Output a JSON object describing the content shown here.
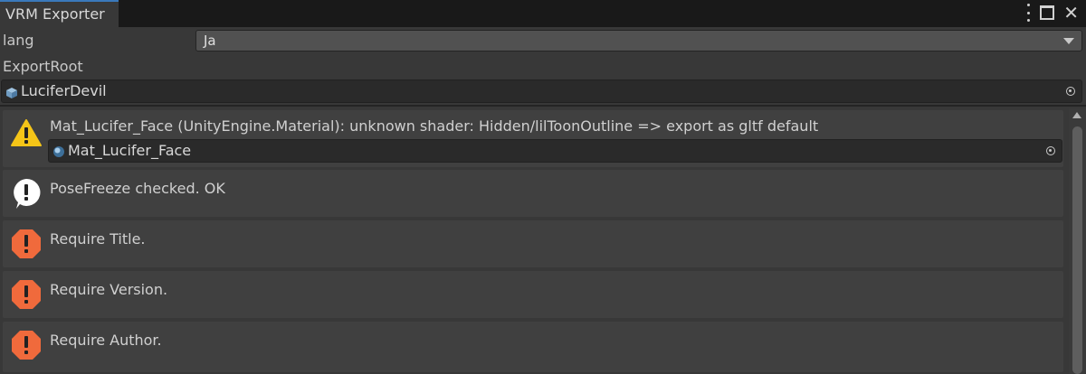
{
  "window": {
    "tab_title": "VRM Exporter",
    "menu_icon": "kebab-menu-icon",
    "maximize_icon": "maximize-icon",
    "close_icon": "close-icon",
    "close_glyph": "✕"
  },
  "settings": {
    "lang_label": "lang",
    "lang_value": "Ja",
    "export_root_label": "ExportRoot",
    "export_root_value": "LuciferDevil",
    "export_root_icon": "prefab-cube-icon"
  },
  "messages": [
    {
      "type": "warning",
      "icon": "warning-icon",
      "text": "Mat_Lucifer_Face (UnityEngine.Material): unknown shader: Hidden/lilToonOutline => export as gltf default",
      "object_field": "Mat_Lucifer_Face",
      "object_icon": "material-sphere-icon"
    },
    {
      "type": "info",
      "icon": "info-icon",
      "text": "PoseFreeze checked. OK"
    },
    {
      "type": "error",
      "icon": "error-icon",
      "text": "Require Title."
    },
    {
      "type": "error",
      "icon": "error-icon",
      "text": "Require Version."
    },
    {
      "type": "error",
      "icon": "error-icon",
      "text": "Require Author."
    }
  ],
  "colors": {
    "background": "#383838",
    "warning": "#f5c518",
    "error": "#f06a3c",
    "info": "#ffffff",
    "tab_accent": "#3a79bb"
  }
}
